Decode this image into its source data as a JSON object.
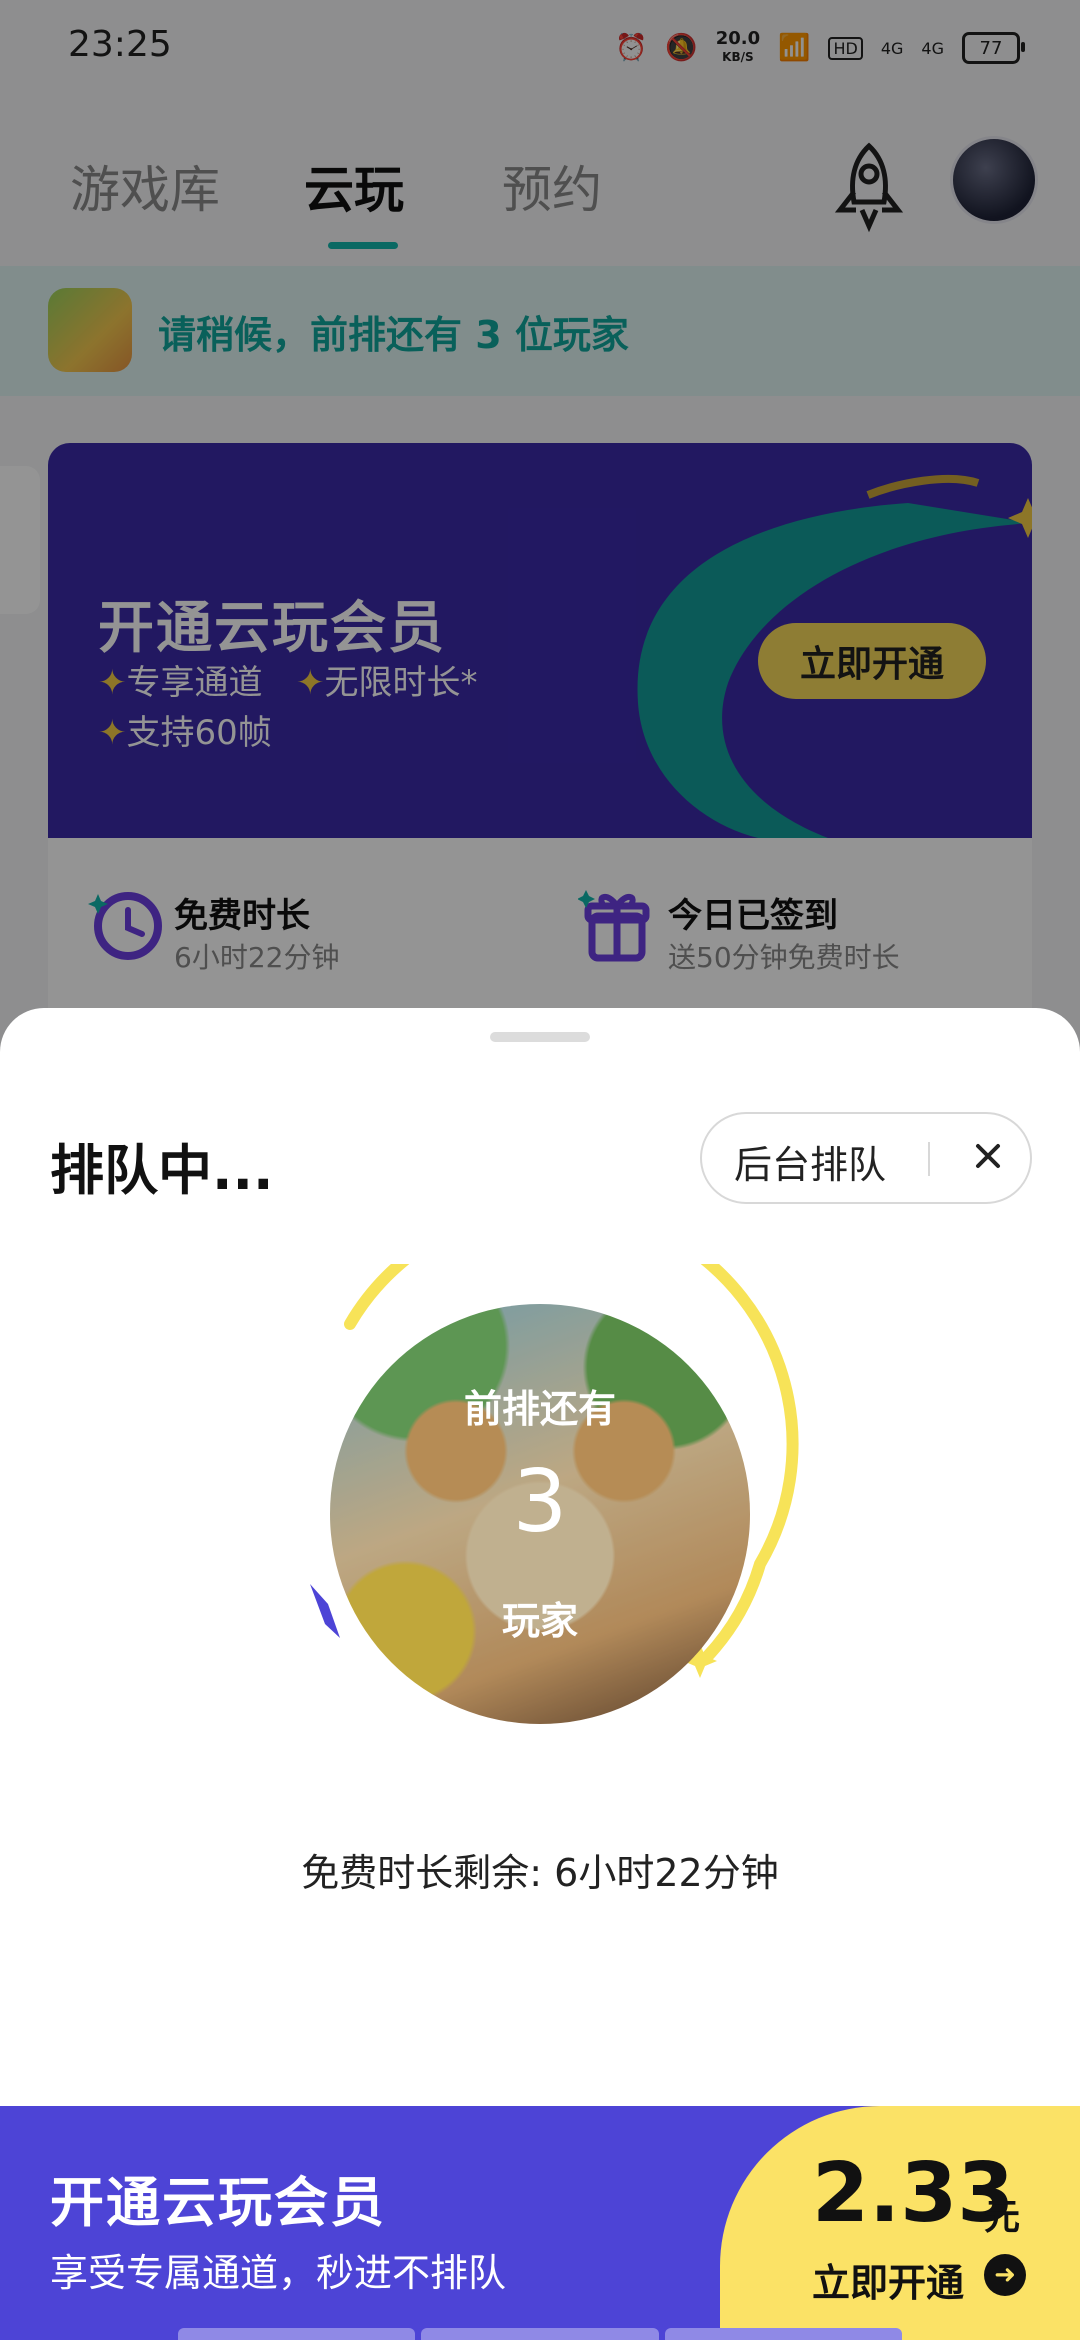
{
  "status_bar": {
    "time": "23:25",
    "net_speed_value": "20.0",
    "net_speed_unit": "KB/S",
    "hd_label": "HD",
    "signal1": "4G",
    "signal2": "4G",
    "battery": "77"
  },
  "nav": {
    "tabs": [
      {
        "label": "游戏库"
      },
      {
        "label": "云玩"
      },
      {
        "label": "预约"
      }
    ],
    "active_tab": "云玩"
  },
  "queue_banner": {
    "text": "请稍候，前排还有 3 位玩家"
  },
  "promo": {
    "title": "开通云玩会员",
    "features": [
      "专享通道",
      "无限时长*",
      "支持60帧"
    ],
    "button": "立即开通"
  },
  "info_card": {
    "free_time_title": "免费时长",
    "free_time_value": "6小时22分钟",
    "checkin_title": "今日已签到",
    "checkin_sub": "送50分钟免费时长"
  },
  "sheet": {
    "title": "排队中...",
    "background_queue_button": "后台排队",
    "circle_top": "前排还有",
    "circle_number": "3",
    "circle_bottom": "玩家",
    "remaining": "免费时长剩余: 6小时22分钟"
  },
  "bottom_promo": {
    "title": "开通云玩会员",
    "subtitle": "享受专属通道，秒进不排队",
    "price": "2.33",
    "unit": "元",
    "cta": "立即开通"
  },
  "colors": {
    "accent_teal": "#12b5ab",
    "promo_purple": "#3b2aa8",
    "yellow": "#f5d85a",
    "bottom_bar": "#4d44d6"
  }
}
